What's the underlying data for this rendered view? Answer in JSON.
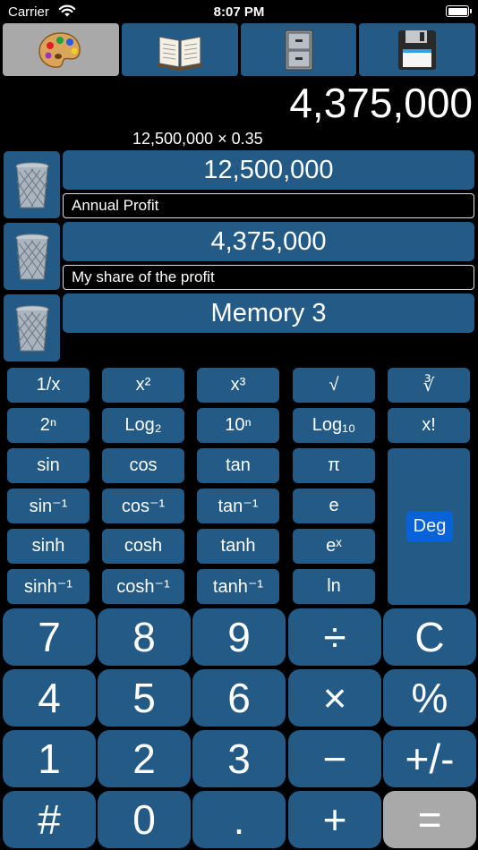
{
  "status_bar": {
    "carrier": "Carrier",
    "time": "8:07 PM",
    "wifi_icon": "wifi-icon",
    "battery_icon": "battery-icon"
  },
  "toolbar": [
    {
      "name": "palette-button",
      "icon": "palette-icon",
      "active": true
    },
    {
      "name": "book-button",
      "icon": "book-icon",
      "active": false
    },
    {
      "name": "file-cabinet-button",
      "icon": "file-cabinet-icon",
      "active": false
    },
    {
      "name": "save-button",
      "icon": "floppy-disk-icon",
      "active": false
    }
  ],
  "display": {
    "result": "4,375,000",
    "expression": "12,500,000 × 0.35"
  },
  "memories": [
    {
      "value": "12,500,000",
      "label": "Annual Profit"
    },
    {
      "value": "4,375,000",
      "label": "My share of the profit"
    },
    {
      "value": "Memory 3",
      "label": ""
    }
  ],
  "scientific_keys": [
    [
      "1/x",
      "x²",
      "x³",
      "√",
      "∛"
    ],
    [
      "2ⁿ",
      "Log₂",
      "10ⁿ",
      "Log₁₀",
      "x!"
    ],
    [
      "sin",
      "cos",
      "tan",
      "π"
    ],
    [
      "sin⁻¹",
      "cos⁻¹",
      "tan⁻¹",
      "e"
    ],
    [
      "sinh",
      "cosh",
      "tanh",
      "eˣ"
    ],
    [
      "sinh⁻¹",
      "cosh⁻¹",
      "tanh⁻¹",
      "ln"
    ]
  ],
  "angle_mode": "Deg",
  "keypad": [
    [
      "7",
      "8",
      "9",
      "÷",
      "C"
    ],
    [
      "4",
      "5",
      "6",
      "×",
      "%"
    ],
    [
      "1",
      "2",
      "3",
      "−",
      "+/-"
    ],
    [
      "#",
      "0",
      ".",
      "+",
      "="
    ]
  ],
  "colors": {
    "key": "#245a86",
    "active": "#a9a9a9",
    "deg": "#0a62d8",
    "background": "#000000"
  }
}
